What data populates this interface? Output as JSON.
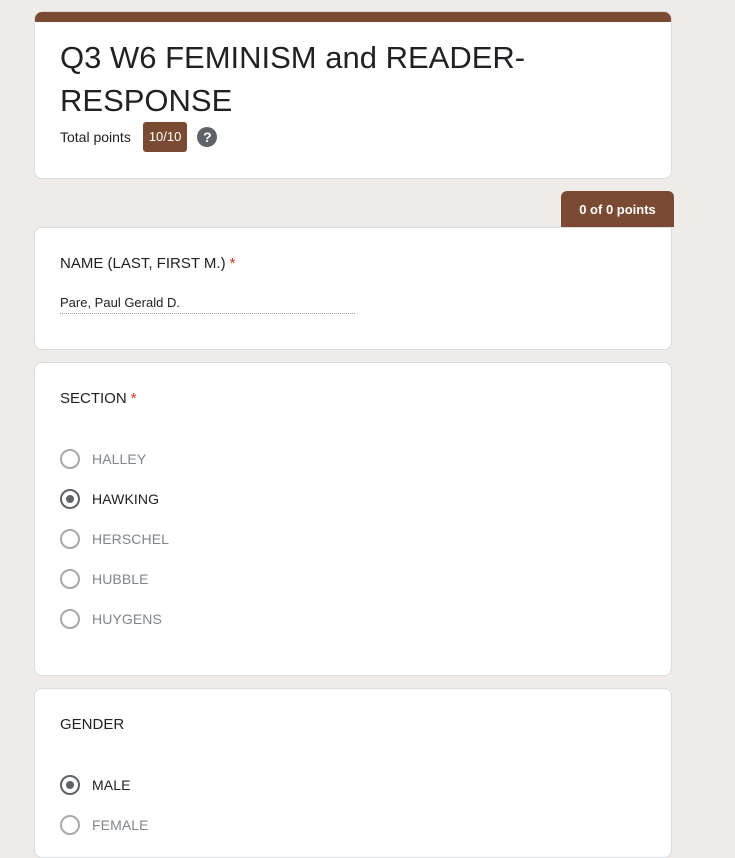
{
  "header": {
    "title": "Q3 W6 FEMINISM and READER-RESPONSE",
    "total_points_label": "Total points",
    "total_points_value": "10/10",
    "help_icon": "help-circle-icon"
  },
  "points_tab": "0 of 0 points",
  "name_question": {
    "title": "NAME (LAST, FIRST M.)",
    "required": "*",
    "answer": "Pare, Paul Gerald D."
  },
  "section_question": {
    "title": "SECTION",
    "required": "*",
    "options": [
      "HALLEY",
      "HAWKING",
      "HERSCHEL",
      "HUBBLE",
      "HUYGENS"
    ],
    "selected": "HAWKING"
  },
  "gender_question": {
    "title": "GENDER",
    "options": [
      "MALE",
      "FEMALE"
    ],
    "selected": "MALE"
  },
  "colors": {
    "accent": "#7b4a32",
    "background": "#efebe9",
    "required": "#d93025"
  }
}
